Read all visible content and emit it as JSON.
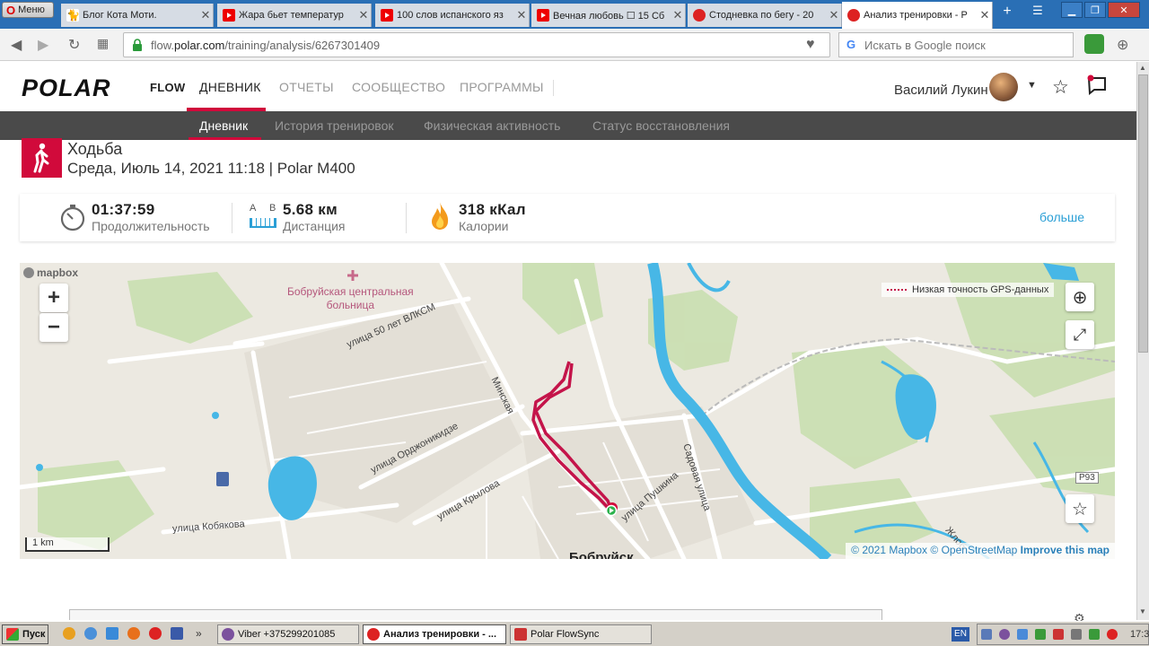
{
  "browser": {
    "menu_label": "Меню",
    "tabs": [
      {
        "title": "Блог Кота Моти.",
        "icon": "cat-icon"
      },
      {
        "title": "Жара бьет температур",
        "icon": "youtube-icon"
      },
      {
        "title": "100 слов испанского яз",
        "icon": "youtube-icon"
      },
      {
        "title": "Вечная любовь ☐ 15 Сб",
        "icon": "youtube-icon"
      },
      {
        "title": "Стодневка по бегу - 20",
        "icon": "stop-icon"
      },
      {
        "title": "Анализ тренировки - Р",
        "icon": "opera-icon"
      }
    ],
    "url_prefix": "flow.",
    "url_domain": "polar.com",
    "url_path": "/training/analysis/6267301409",
    "search_placeholder": "Искать в Google поиск"
  },
  "polar": {
    "logo": "POLAR",
    "nav": {
      "flow": "FLOW",
      "diary": "ДНЕВНИК",
      "reports": "ОТЧЕТЫ",
      "community": "СООБЩЕСТВО",
      "programs": "ПРОГРАММЫ"
    },
    "user_name": "Василий Лукин",
    "subnav": [
      "Дневник",
      "История тренировок",
      "Физическая активность",
      "Статус восстановления"
    ],
    "activity": {
      "title": "Ходьба",
      "date_line": "Среда, Июль 14, 2021 11:18 | Polar M400"
    },
    "stats": [
      {
        "value": "01:37:59",
        "label": "Продолжительность",
        "icon": "stopwatch-icon"
      },
      {
        "value": "5.68 км",
        "label": "Дистанция",
        "icon": "distance-icon",
        "ab": [
          "A",
          "B"
        ]
      },
      {
        "value": "318 кКал",
        "label": "Калории",
        "icon": "flame-icon"
      }
    ],
    "more_link": "больше"
  },
  "map": {
    "mapbox_logo": "mapbox",
    "hospital": [
      "Бобруйская центральная",
      "больница"
    ],
    "legend": "Низкая точность GPS-данных",
    "streets": {
      "s1": "улица 50 лет ВЛКСМ",
      "s2": "Минская",
      "s3": "улица Орджоникидзе",
      "s4": "улица Крылова",
      "s5": "улица Пушкина",
      "s6": "Садовая улица",
      "s7": "улица Кобякова",
      "s8": "Жлоб",
      "s9": "Р93",
      "s10": "Бобруйск"
    },
    "scale": "1 km",
    "attribution_1": "© 2021 Mapbox",
    "attribution_2": "© OpenStreetMap",
    "attribution_3": "Improve this map",
    "zoom_in": "+",
    "zoom_out": "−"
  },
  "taskbar": {
    "start": "Пуск",
    "items": [
      {
        "label": "Viber +375299201085",
        "active": false
      },
      {
        "label": "Анализ тренировки - ...",
        "active": true
      },
      {
        "label": "Polar FlowSync",
        "active": false
      }
    ],
    "lang": "EN",
    "time": "17:32"
  },
  "colors": {
    "polar_red": "#d10a3b",
    "link_blue": "#2a9fd6",
    "route": "#c4144a",
    "water": "#47b7e6"
  }
}
